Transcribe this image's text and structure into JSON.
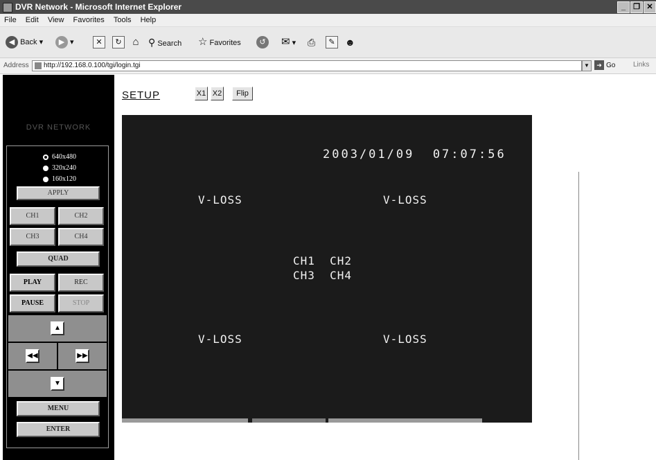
{
  "window": {
    "title": "DVR Network - Microsoft Internet Explorer",
    "controls": [
      "_",
      "❐",
      "✕"
    ]
  },
  "menu": [
    "File",
    "Edit",
    "View",
    "Favorites",
    "Tools",
    "Help"
  ],
  "toolbar": {
    "back_label": "Back",
    "search_label": "Search",
    "favorites_label": "Favorites"
  },
  "address": {
    "label": "Address",
    "url": "http://192.168.0.100/tgi/login.tgi",
    "go_label": "Go",
    "links_label": "Links"
  },
  "panel": {
    "brand": "DVR  NETWORK",
    "resolutions": [
      {
        "label": "640x480",
        "selected": true
      },
      {
        "label": "320x240",
        "selected": false
      },
      {
        "label": "160x120",
        "selected": false
      }
    ],
    "apply": "APPLY",
    "channels": [
      "CH1",
      "CH2",
      "CH3",
      "CH4"
    ],
    "quad": "QUAD",
    "play": "PLAY",
    "rec": "REC",
    "pause": "PAUSE",
    "stop": "STOP",
    "menu": "MENU",
    "enter": "ENTER"
  },
  "setup": {
    "link": "SETUP",
    "x1": "X1",
    "x2": "X2",
    "flip": "Flip"
  },
  "video": {
    "timestamp": "2003/01/09  07:07:56",
    "vloss": [
      "V-LOSS",
      "V-LOSS",
      "V-LOSS",
      "V-LOSS"
    ],
    "ch_row1": "CH1  CH2",
    "ch_row2": "CH3  CH4"
  }
}
